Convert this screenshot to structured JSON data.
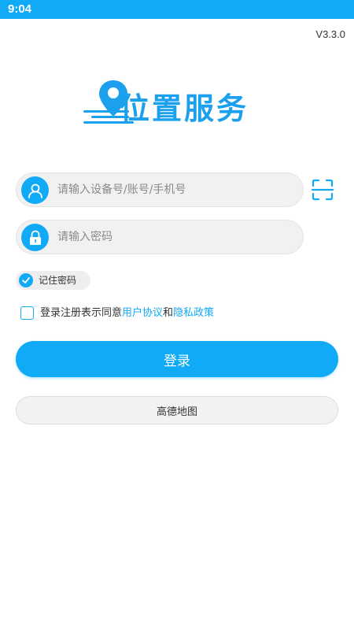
{
  "status_bar": {
    "time": "9:04",
    "color": "#11aaf6"
  },
  "app": {
    "version": "V3.3.0",
    "logo_text": "位置服务",
    "accent_color": "#11aaf6"
  },
  "login_form": {
    "account_input": {
      "placeholder": "请输入设备号/账号/手机号",
      "value": "",
      "icon": "user-icon"
    },
    "password_input": {
      "placeholder": "请输入密码",
      "value": "",
      "icon": "lock-icon"
    },
    "scan_icon": "scan-icon",
    "remember": {
      "label": "记住密码",
      "checked": true
    },
    "agreement": {
      "prefix": "登录注册表示同意",
      "user_agreement": "用户协议",
      "connector": "和",
      "privacy_policy": "隐私政策",
      "checked": false
    },
    "login_label": "登录",
    "map_option_label": "高德地图"
  }
}
